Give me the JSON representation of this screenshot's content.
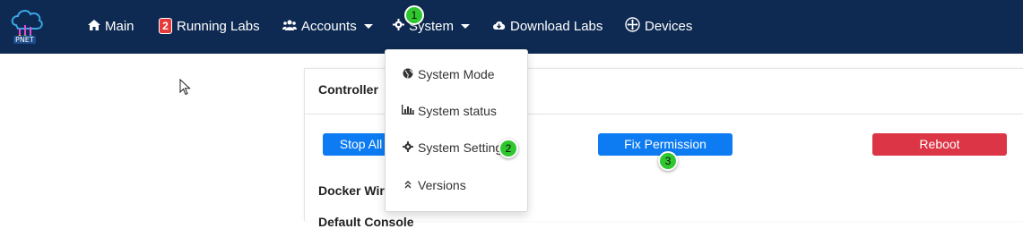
{
  "navbar": {
    "logo_text": "PNET",
    "items": [
      {
        "label": "Main",
        "icon": "home-icon"
      },
      {
        "label": "Running Labs",
        "badge": "2"
      },
      {
        "label": "Accounts",
        "icon": "users-icon"
      },
      {
        "label": "System",
        "icon": "gear-icon"
      },
      {
        "label": "Download Labs",
        "icon": "cloud-download-icon"
      },
      {
        "label": "Devices",
        "icon": "devices-icon"
      }
    ]
  },
  "dropdown": {
    "items": [
      {
        "label": "System Mode",
        "icon": "globe-icon"
      },
      {
        "label": "System status",
        "icon": "bar-chart-icon"
      },
      {
        "label": "System Settings",
        "icon": "gear-icon"
      },
      {
        "label": "Versions",
        "icon": "angle-double-up-icon"
      }
    ]
  },
  "panel": {
    "title": "Controller",
    "buttons": {
      "stop": "Stop All",
      "fix_permission": "Fix Permission",
      "reboot": "Reboot"
    },
    "section_docker": "Docker Wireshark",
    "section_default": "Default Console"
  },
  "steps": {
    "one": "1",
    "two": "2",
    "three": "3"
  },
  "colors": {
    "navbar": "#0e2a52",
    "primary": "#0d7bf2",
    "danger": "#dc3545",
    "step": "#2fc72f"
  }
}
